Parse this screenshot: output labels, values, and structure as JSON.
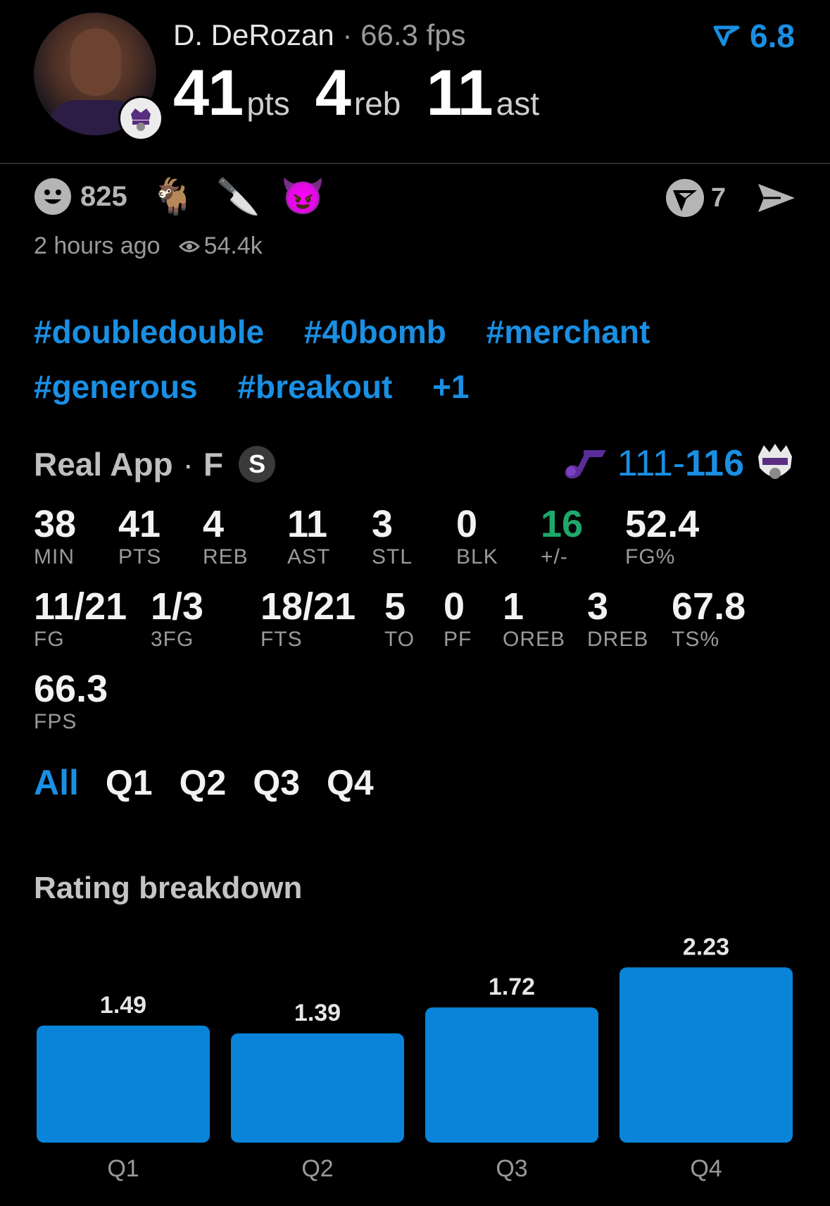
{
  "player": {
    "name": "D. DeRozan",
    "separator": "·",
    "fps_label": "66.3 fps",
    "team_logo_text": "SACRAMENTO KINGS",
    "headline": [
      {
        "value": "41",
        "unit": "pts"
      },
      {
        "value": "4",
        "unit": "reb"
      },
      {
        "value": "11",
        "unit": "ast"
      }
    ],
    "rating": "6.8"
  },
  "reactions": {
    "smile_count": "825",
    "emojis": [
      "🐐",
      "🔪",
      "😈"
    ],
    "comment_count": "7"
  },
  "meta": {
    "time_ago": "2 hours ago",
    "views": "54.4k"
  },
  "tags": [
    "#doubledouble",
    "#40bomb",
    "#merchant",
    "#generous",
    "#breakout",
    "+1"
  ],
  "game": {
    "source": "Real App",
    "separator": "·",
    "status": "F",
    "badge": "S",
    "score_left": "111-",
    "score_right": "116"
  },
  "stats": [
    {
      "value": "38",
      "label": "MIN"
    },
    {
      "value": "41",
      "label": "PTS"
    },
    {
      "value": "4",
      "label": "REB"
    },
    {
      "value": "11",
      "label": "AST"
    },
    {
      "value": "3",
      "label": "STL"
    },
    {
      "value": "0",
      "label": "BLK"
    },
    {
      "value": "16",
      "label": "+/-"
    },
    {
      "value": "52.4",
      "label": "FG%"
    },
    {
      "value": "11/21",
      "label": "FG"
    },
    {
      "value": "1/3",
      "label": "3FG"
    },
    {
      "value": "18/21",
      "label": "FTS"
    },
    {
      "value": "5",
      "label": "TO"
    },
    {
      "value": "0",
      "label": "PF"
    },
    {
      "value": "1",
      "label": "OREB"
    },
    {
      "value": "3",
      "label": "DREB"
    },
    {
      "value": "67.8",
      "label": "TS%"
    },
    {
      "value": "66.3",
      "label": "FPS"
    }
  ],
  "tabs": [
    "All",
    "Q1",
    "Q2",
    "Q3",
    "Q4"
  ],
  "section_title": "Rating breakdown",
  "colors": {
    "accent": "#1a8fe3",
    "bar": "#0a84d8",
    "positive": "#1ea86a"
  },
  "chart_data": {
    "type": "bar",
    "categories": [
      "Q1",
      "Q2",
      "Q3",
      "Q4"
    ],
    "values": [
      1.49,
      1.39,
      1.72,
      2.23
    ],
    "data_labels": [
      "1.49",
      "1.39",
      "1.72",
      "2.23"
    ],
    "title": "",
    "xlabel": "",
    "ylabel": "",
    "ylim": [
      0,
      2.3
    ],
    "grid": false
  }
}
